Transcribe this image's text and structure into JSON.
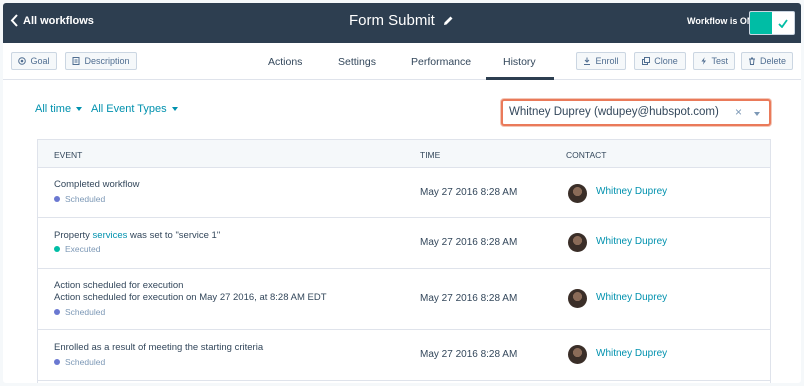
{
  "header": {
    "back_label": "All workflows",
    "title": "Form Submit",
    "status_label": "Workflow is ON"
  },
  "toolbar": {
    "goal": "Goal",
    "description": "Description",
    "enroll": "Enroll",
    "clone": "Clone",
    "test": "Test",
    "delete": "Delete"
  },
  "tabs": [
    "Actions",
    "Settings",
    "Performance",
    "History"
  ],
  "active_tab": "History",
  "filters": {
    "time": "All time",
    "event_types": "All Event Types",
    "contact": "Whitney Duprey (wdupey@hubspot.com)"
  },
  "table": {
    "headers": {
      "event": "EVENT",
      "time": "TIME",
      "contact": "CONTACT"
    },
    "rows": [
      {
        "event_lines": [
          "Completed workflow"
        ],
        "status": "Scheduled",
        "time": "May 27 2016 8:28 AM",
        "contact": "Whitney Duprey"
      },
      {
        "event_prefix": "Property ",
        "event_link": "services",
        "event_suffix": " was set to \"service 1\"",
        "status": "Executed",
        "time": "May 27 2016 8:28 AM",
        "contact": "Whitney Duprey"
      },
      {
        "event_lines": [
          "Action scheduled for execution",
          "Action scheduled for execution on May 27 2016, at 8:28 AM EDT"
        ],
        "status": "Scheduled",
        "time": "May 27 2016 8:28 AM",
        "contact": "Whitney Duprey"
      },
      {
        "event_lines": [
          "Enrolled as a result of meeting the starting criteria"
        ],
        "status": "Scheduled",
        "time": "May 27 2016 8:28 AM",
        "contact": "Whitney Duprey"
      }
    ]
  },
  "colors": {
    "scheduled": "#6a78d1",
    "executed": "#00bda5",
    "accent": "#0091ae",
    "header_bg": "#2d3e50",
    "highlight": "#ea7a5a"
  }
}
